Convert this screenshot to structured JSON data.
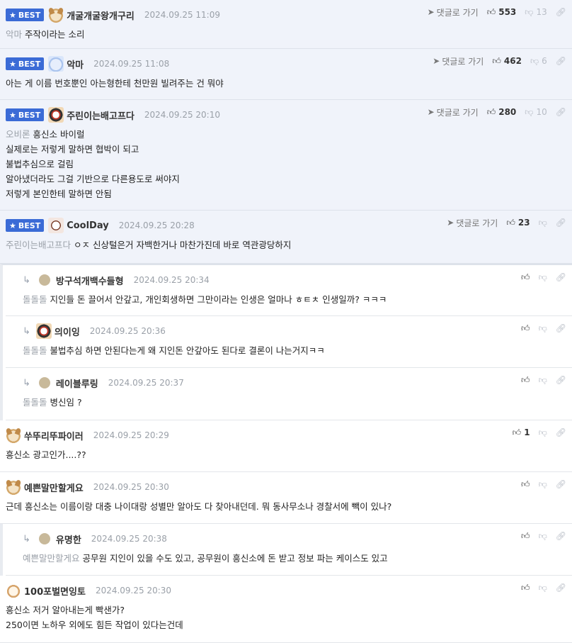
{
  "labels": {
    "best": "BEST",
    "reply_go": "댓글로 가기"
  },
  "comments": [
    {
      "nick": "개굴개굴왕개구리",
      "date": "2024.09.25 11:09",
      "mention": "악마",
      "lines": [
        "주작이라는 소리"
      ],
      "up": "553",
      "down": "13"
    },
    {
      "nick": "악마",
      "date": "2024.09.25 11:08",
      "mention": "",
      "lines": [
        "아는 게 이름 번호뿐인 아는형한테 천만원 빌려주는 건 뭐야"
      ],
      "up": "462",
      "down": "6"
    },
    {
      "nick": "주린이는배고프다",
      "date": "2024.09.25 20:10",
      "mention": "오비론",
      "lines": [
        "흥신소 바이럴",
        "실제로는 저렇게 말하면 협박이 되고",
        "불법추심으로 걸림",
        "알아냈더라도 그걸 기반으로 다른용도로 써야지",
        "저렇게 본인한테 말하면 안됨"
      ],
      "up": "280",
      "down": "10"
    },
    {
      "nick": "CoolDay",
      "date": "2024.09.25 20:28",
      "mention": "주린이는배고프다",
      "lines": [
        "ㅇㅈ 신상털은거 자백한거나 마찬가진데 바로 역관광당하지"
      ],
      "up": "23",
      "down": ""
    },
    {
      "nick": "방구석개백수들형",
      "date": "2024.09.25 20:34",
      "mention": "돌돌돌",
      "lines": [
        "지인들 돈 끌어서 안갚고, 개인회생하면 그만이라는 인생은 얼마나 ㅎㅌㅊ 인생일까? ㅋㅋㅋ"
      ],
      "up": "",
      "down": ""
    },
    {
      "nick": "의이잉",
      "date": "2024.09.25 20:36",
      "mention": "돌돌돌",
      "lines": [
        "불법추심 하면 안된다는게 왜 지인돈 안갚아도 된다로 결론이 나는거지ㅋㅋ"
      ],
      "up": "",
      "down": ""
    },
    {
      "nick": "레이블루링",
      "date": "2024.09.25 20:37",
      "mention": "돌돌돌",
      "lines": [
        "병신임 ?"
      ],
      "up": "",
      "down": ""
    },
    {
      "nick": "쑤뚜리뚜파이러",
      "date": "2024.09.25 20:29",
      "mention": "",
      "lines": [
        "흥신소 광고인가....??"
      ],
      "up": "1",
      "down": ""
    },
    {
      "nick": "예쁜말만할게요",
      "date": "2024.09.25 20:30",
      "mention": "",
      "lines": [
        "근데 흥신소는 이름이랑 대충 나이대랑 성별만 알아도 다 찾아내던데. 뭐 동사무소나 경찰서에 빽이 있나?"
      ],
      "up": "",
      "down": ""
    },
    {
      "nick": "유명한",
      "date": "2024.09.25 20:38",
      "mention": "예쁜말만할게요",
      "lines": [
        "공무원 지인이 있을 수도 있고, 공무원이 흥신소에 돈 받고 정보 파는 케이스도 있고"
      ],
      "up": "",
      "down": ""
    },
    {
      "nick": "100포벌면잉토",
      "date": "2024.09.25 20:30",
      "mention": "",
      "lines": [
        "흥신소 저거 알아내는게 빡샌가?",
        "250이면 노하우 외에도 힘든 작업이 있다는건데"
      ],
      "up": "",
      "down": ""
    }
  ]
}
